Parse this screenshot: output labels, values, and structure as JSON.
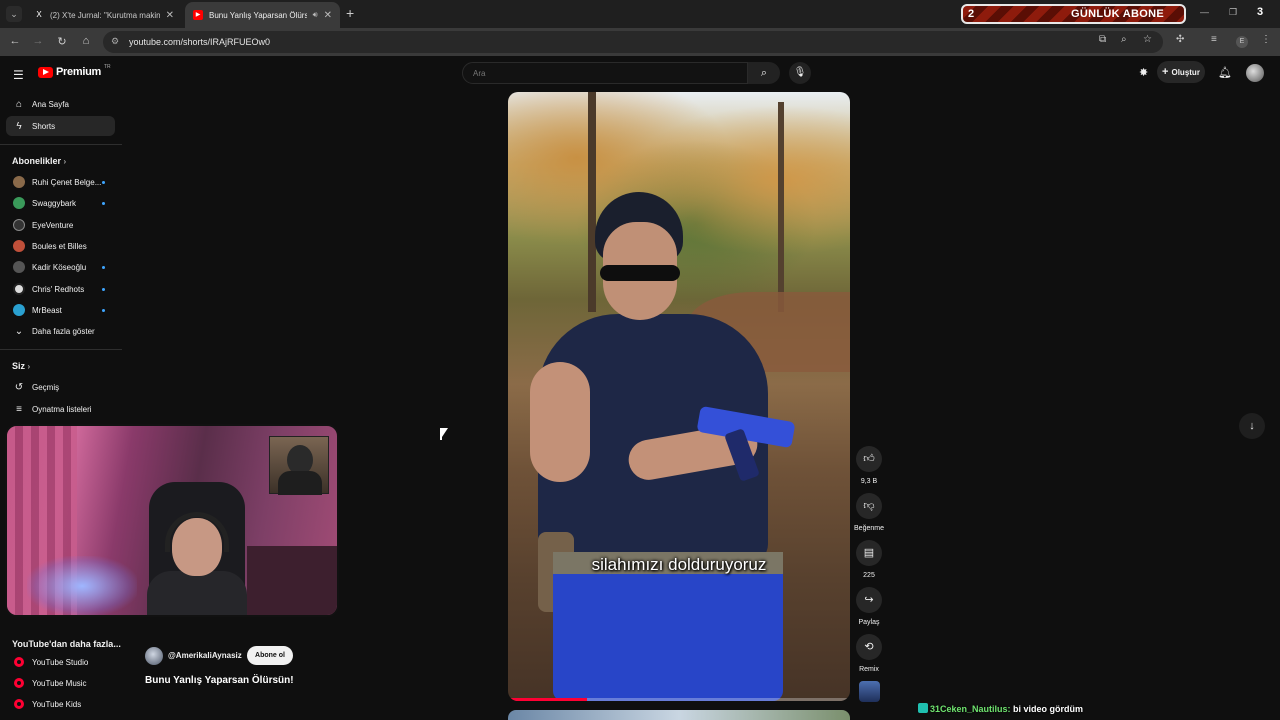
{
  "browser": {
    "tabs": [
      {
        "title": "(2) X'te Jurnal: \"Kurutma makin...",
        "active": false
      },
      {
        "title": "Bunu Yanlış Yaparsan Ölürsün!",
        "active": true
      }
    ],
    "url": "youtube.com/shorts/IRAjRFUEOw0"
  },
  "overlay": {
    "left_number": "2",
    "label": "GÜNLÜK ABONE",
    "right_number": "3"
  },
  "header": {
    "logo_text": "Premium",
    "region": "TR",
    "search_placeholder": "Ara",
    "create_label": "Oluştur"
  },
  "sidebar": {
    "main": [
      {
        "label": "Ana Sayfa",
        "icon": "home-icon"
      },
      {
        "label": "Shorts",
        "icon": "shorts-icon",
        "active": true
      }
    ],
    "subscriptions_title": "Abonelikler",
    "subscriptions": [
      {
        "label": "Ruhi Çenet Belge...",
        "color": "#8a6a4a",
        "new": true
      },
      {
        "label": "Swaggybark",
        "color": "#3a9a5a",
        "new": true
      },
      {
        "label": "EyeVenture",
        "color": "#333333",
        "new": false
      },
      {
        "label": "Boules et Billes",
        "color": "#c0503a",
        "new": false
      },
      {
        "label": "Kadir Köseoğlu",
        "color": "#555555",
        "new": true
      },
      {
        "label": "Chris' Redhots",
        "color": "#dddddd",
        "new": true
      },
      {
        "label": "MrBeast",
        "color": "#2aa0d0",
        "new": true
      }
    ],
    "show_more": "Daha fazla göster",
    "you_title": "Siz",
    "you_items": [
      {
        "label": "Geçmiş",
        "icon": "history-icon"
      },
      {
        "label": "Oynatma listeleri",
        "icon": "playlist-icon"
      }
    ],
    "more_title": "YouTube'dan daha fazla...",
    "more_items": [
      {
        "label": "YouTube Studio"
      },
      {
        "label": "YouTube Music"
      },
      {
        "label": "YouTube Kids"
      }
    ]
  },
  "video": {
    "channel": "@AmerikaliAynasiz",
    "subscribe_label": "Abone ol",
    "title": "Bunu Yanlış Yaparsan Ölürsün!",
    "caption": "silahımızı dolduruyoruz",
    "progress_fraction": 0.23
  },
  "actions": {
    "likes": "9,3 B",
    "dislike_label": "Beğenme",
    "comments": "225",
    "share_label": "Paylaş",
    "remix_label": "Remix"
  },
  "chat": {
    "user": "31Ceken_Nautilus:",
    "message": "bi video gördüm"
  }
}
